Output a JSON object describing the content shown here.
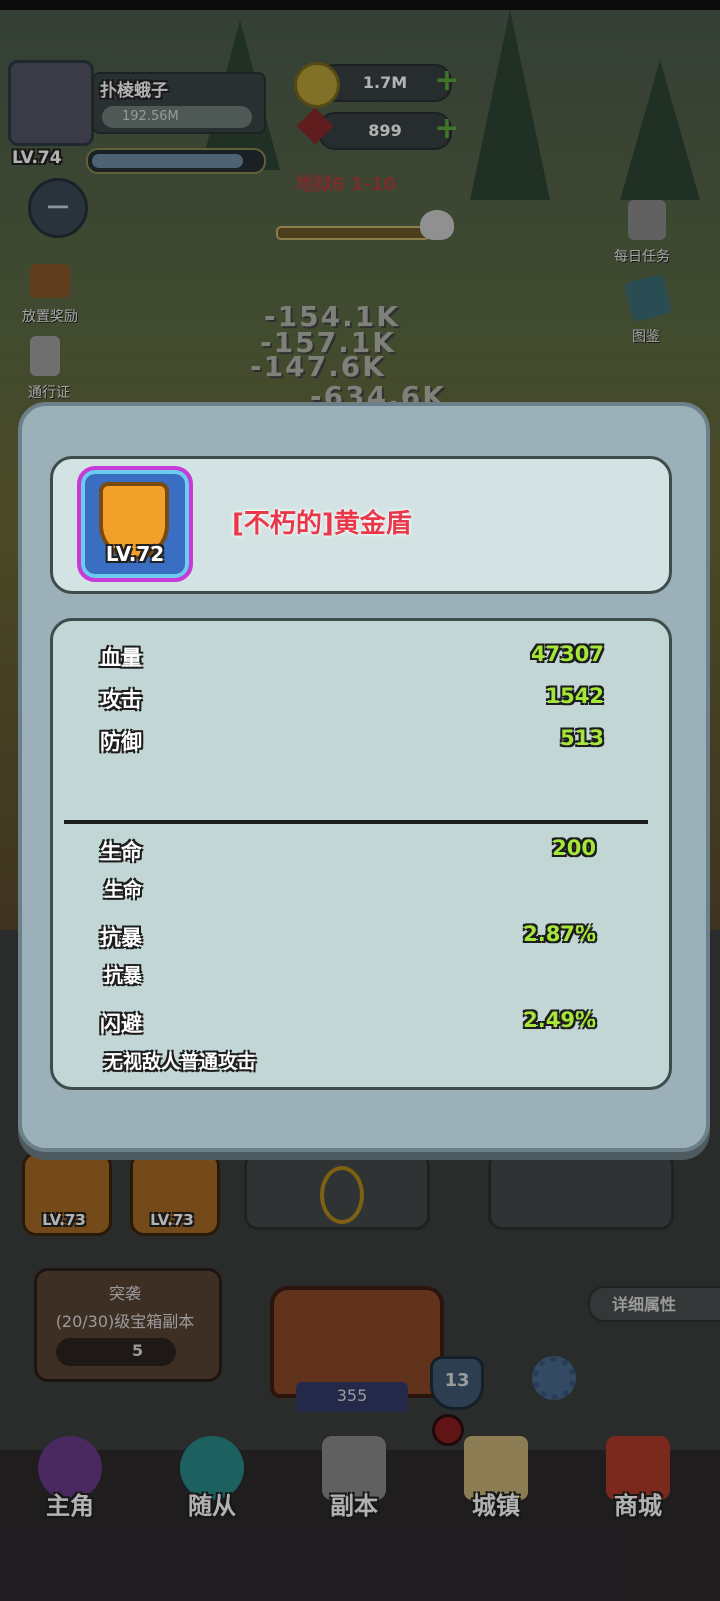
{
  "player": {
    "name": "扑棱蛾子",
    "power": "192.56M",
    "level": "LV.74",
    "xp_fraction": 0.92
  },
  "currency": {
    "gold": "1.7M",
    "gems": "899"
  },
  "stage": "地狱6 1-10",
  "side_menu": {
    "idle_reward": "放置奖励",
    "pass": "通行证",
    "daily_tasks": "每日任务",
    "codex": "图鉴"
  },
  "damage_numbers": [
    "-154.1K",
    "-157.1K",
    "-147.6K",
    "-634.6K"
  ],
  "item": {
    "level": "LV.72",
    "name": "[不朽的]黄金盾",
    "base_stats": [
      {
        "label": "血量",
        "value": "47307"
      },
      {
        "label": "攻击",
        "value": "1542"
      },
      {
        "label": "防御",
        "value": "513"
      }
    ],
    "bonus_stats": [
      {
        "label": "生命",
        "value": "200",
        "desc": "生命"
      },
      {
        "label": "抗暴",
        "value": "2.87%",
        "desc": "抗暴"
      },
      {
        "label": "闪避",
        "value": "2.49%",
        "desc": "无视敌人普通攻击"
      }
    ]
  },
  "equipment": {
    "slot1_level": "LV.73",
    "slot2_level": "LV.73"
  },
  "raid": {
    "title": "突袭",
    "subtitle": "(20/30)级宝箱副本",
    "count": "5"
  },
  "detail_button": "详细属性",
  "chest": {
    "count": "355",
    "badge": "13"
  },
  "nav": {
    "hero": "主角",
    "followers": "随从",
    "dungeon": "副本",
    "town": "城镇",
    "shop": "商城"
  }
}
